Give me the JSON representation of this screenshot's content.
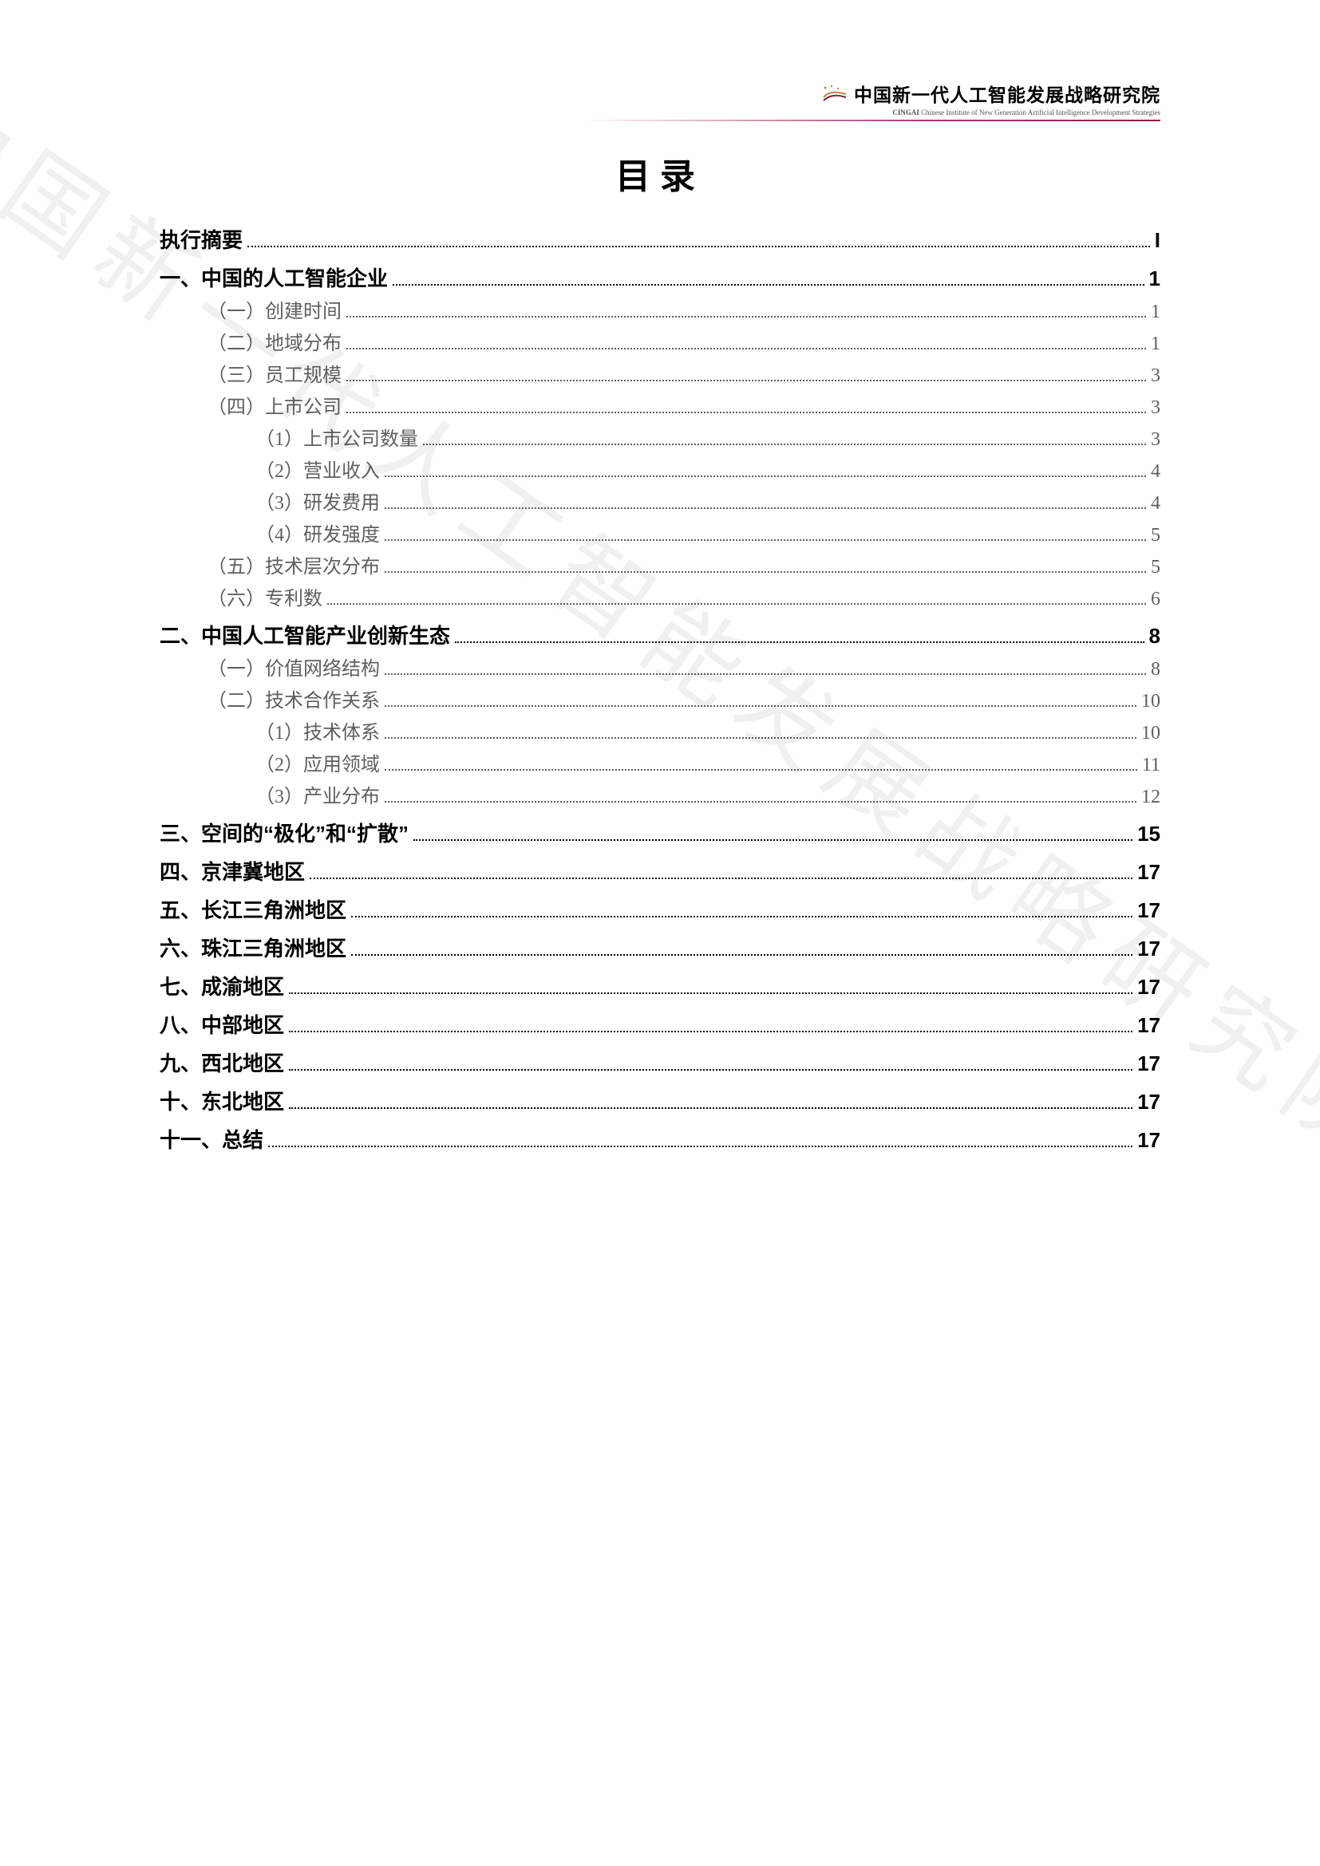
{
  "header": {
    "org_cn": "中国新一代人工智能发展战略研究院",
    "org_en_prefix": "CINGAI",
    "org_en": "Chinese Institute of New Generation Artificial Intelligence Development Strategies"
  },
  "title": "目录",
  "watermark": "中国新一代人工智能发展战略研究院",
  "toc": [
    {
      "level": 0,
      "label": "执行摘要",
      "page": "I"
    },
    {
      "level": 0,
      "label": "一、中国的人工智能企业",
      "page": "1"
    },
    {
      "level": 1,
      "label": "（一）创建时间",
      "page": "1"
    },
    {
      "level": 1,
      "label": "（二）地域分布",
      "page": "1"
    },
    {
      "level": 1,
      "label": "（三）员工规模",
      "page": "3"
    },
    {
      "level": 1,
      "label": "（四）上市公司",
      "page": "3"
    },
    {
      "level": 2,
      "label": "（1）上市公司数量",
      "page": "3"
    },
    {
      "level": 2,
      "label": "（2）营业收入",
      "page": "4"
    },
    {
      "level": 2,
      "label": "（3）研发费用",
      "page": "4"
    },
    {
      "level": 2,
      "label": "（4）研发强度",
      "page": "5"
    },
    {
      "level": 1,
      "label": "（五）技术层次分布",
      "page": "5"
    },
    {
      "level": 1,
      "label": "（六）专利数",
      "page": "6"
    },
    {
      "level": 0,
      "label": "二、中国人工智能产业创新生态",
      "page": "8"
    },
    {
      "level": 1,
      "label": "（一）价值网络结构",
      "page": "8"
    },
    {
      "level": 1,
      "label": "（二）技术合作关系",
      "page": "10"
    },
    {
      "level": 2,
      "label": "（1）技术体系",
      "page": "10"
    },
    {
      "level": 2,
      "label": "（2）应用领域",
      "page": "11"
    },
    {
      "level": 2,
      "label": "（3）产业分布",
      "page": "12"
    },
    {
      "level": 0,
      "label": "三、空间的“极化”和“扩散”",
      "page": "15"
    },
    {
      "level": 0,
      "label": "四、京津冀地区",
      "page": "17"
    },
    {
      "level": 0,
      "label": "五、长江三角洲地区",
      "page": "17"
    },
    {
      "level": 0,
      "label": "六、珠江三角洲地区",
      "page": "17"
    },
    {
      "level": 0,
      "label": "七、成渝地区",
      "page": "17"
    },
    {
      "level": 0,
      "label": "八、中部地区",
      "page": "17"
    },
    {
      "level": 0,
      "label": "九、西北地区",
      "page": "17"
    },
    {
      "level": 0,
      "label": "十、东北地区",
      "page": "17"
    },
    {
      "level": 0,
      "label": "十一、总结",
      "page": "17"
    }
  ]
}
